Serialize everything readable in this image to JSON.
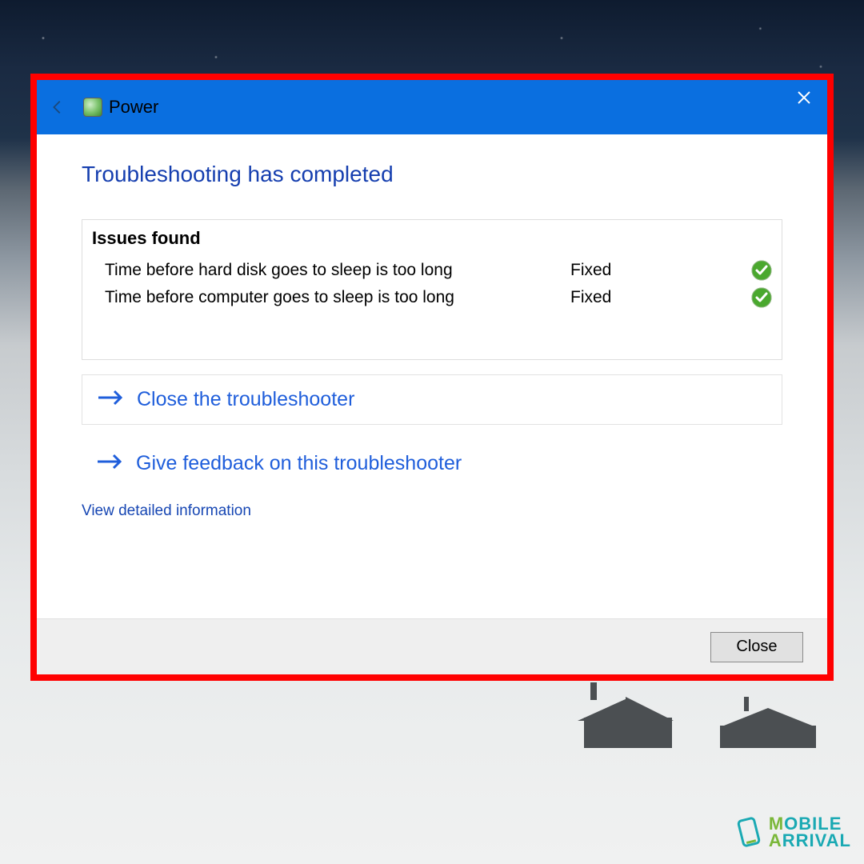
{
  "titlebar": {
    "app_label": "Power"
  },
  "content": {
    "heading": "Troubleshooting has completed",
    "issues_header": "Issues found",
    "issues": [
      {
        "label": "Time before hard disk goes to sleep is too long",
        "status": "Fixed"
      },
      {
        "label": "Time before computer goes to sleep is too long",
        "status": "Fixed"
      }
    ],
    "close_troubleshooter_label": "Close the troubleshooter",
    "feedback_label": "Give feedback on this troubleshooter",
    "detail_link_label": "View detailed information"
  },
  "footer": {
    "close_label": "Close"
  },
  "watermark": {
    "line1_initial": "M",
    "line1_rest": "OBILE",
    "line2_initial": "A",
    "line2_rest": "RRIVAL"
  }
}
